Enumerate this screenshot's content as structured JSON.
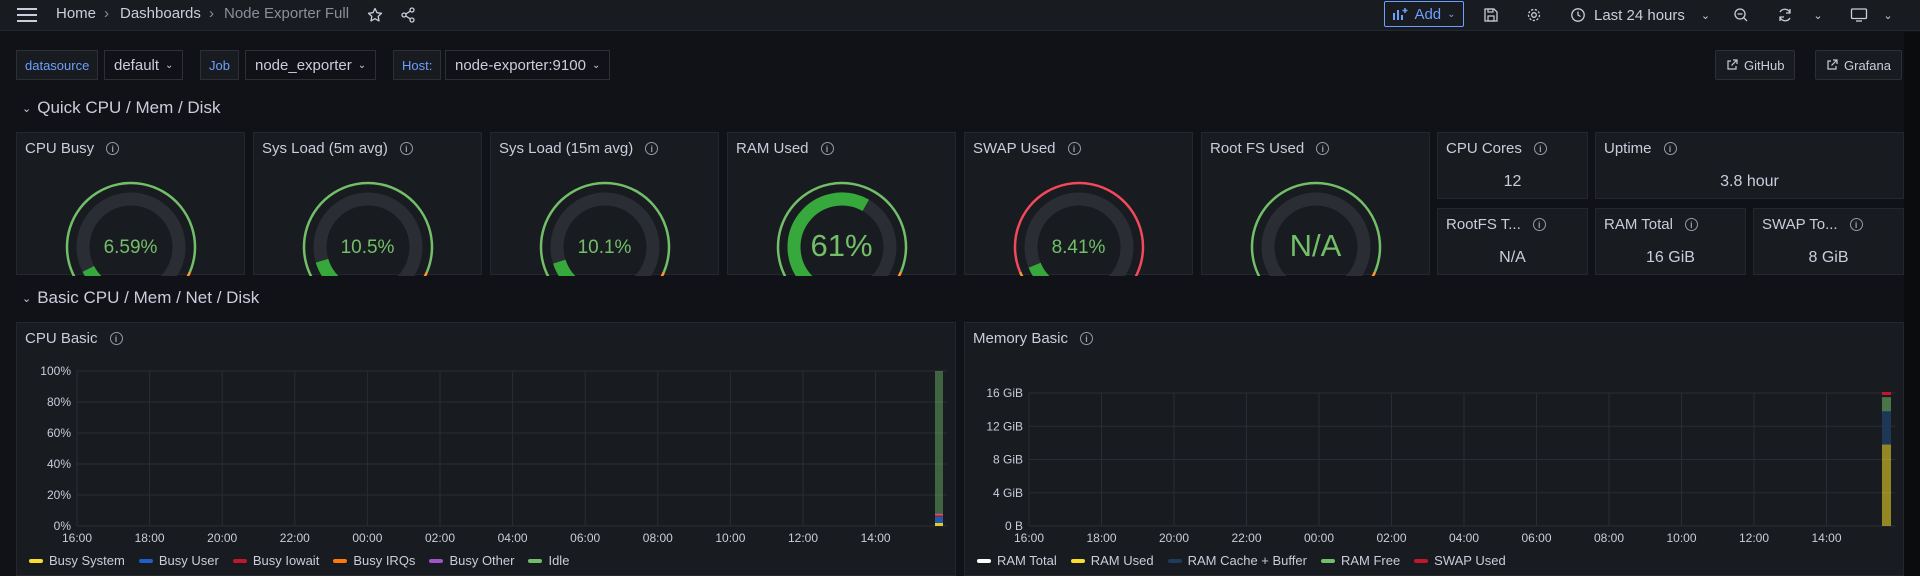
{
  "nav": {
    "breadcrumb": [
      "Home",
      "Dashboards",
      "Node Exporter Full"
    ],
    "add_label": "Add",
    "time_range": "Last 24 hours"
  },
  "variables": [
    {
      "label": "datasource",
      "value": "default"
    },
    {
      "label": "Job",
      "value": "node_exporter"
    },
    {
      "label": "Host:",
      "value": "node-exporter:9100"
    }
  ],
  "links": [
    "GitHub",
    "Grafana"
  ],
  "rows": {
    "quick": "Quick CPU / Mem / Disk",
    "basic": "Basic CPU / Mem / Net / Disk"
  },
  "gauges": [
    {
      "title": "CPU Busy",
      "value": "6.59%",
      "fraction": 0.066,
      "threshold": "green-orange-red"
    },
    {
      "title": "Sys Load (5m avg)",
      "value": "10.5%",
      "fraction": 0.105,
      "threshold": "green-orange-red"
    },
    {
      "title": "Sys Load (15m avg)",
      "value": "10.1%",
      "fraction": 0.101,
      "threshold": "green-orange-red"
    },
    {
      "title": "RAM Used",
      "value": "61%",
      "fraction": 0.61,
      "threshold": "green-orange-red"
    },
    {
      "title": "SWAP Used",
      "value": "8.41%",
      "fraction": 0.084,
      "threshold": "orange-red"
    },
    {
      "title": "Root FS Used",
      "value": "N/A",
      "fraction": 0,
      "threshold": "green-orange-red"
    }
  ],
  "stats": [
    {
      "title": "CPU Cores",
      "value": "12"
    },
    {
      "title": "Uptime",
      "value": "3.8 hour"
    },
    {
      "title": "RootFS T...",
      "value": "N/A"
    },
    {
      "title": "RAM Total",
      "value": "16 GiB"
    },
    {
      "title": "SWAP To...",
      "value": "8 GiB"
    }
  ],
  "panels": {
    "cpu_basic": "CPU Basic",
    "memory_basic": "Memory Basic"
  },
  "chart_data": [
    {
      "type": "area",
      "title": "CPU Basic",
      "y_ticks": [
        "100%",
        "80%",
        "60%",
        "40%",
        "20%",
        "0%"
      ],
      "x_ticks": [
        "16:00",
        "18:00",
        "20:00",
        "22:00",
        "00:00",
        "02:00",
        "04:00",
        "06:00",
        "08:00",
        "10:00",
        "12:00",
        "14:00"
      ],
      "ylim": [
        0,
        100
      ],
      "grid": true,
      "series": [
        {
          "name": "Busy System",
          "color": "#fade2a",
          "values": [
            2
          ]
        },
        {
          "name": "Busy User",
          "color": "#1f60c4",
          "values": [
            4
          ]
        },
        {
          "name": "Busy Iowait",
          "color": "#c4162a",
          "values": [
            1
          ]
        },
        {
          "name": "Busy IRQs",
          "color": "#ff780a",
          "values": [
            0.5
          ]
        },
        {
          "name": "Busy Other",
          "color": "#a352cc",
          "values": [
            0.5
          ]
        },
        {
          "name": "Idle",
          "color": "#73bf69",
          "values": [
            92
          ]
        }
      ]
    },
    {
      "type": "area",
      "title": "Memory Basic",
      "y_ticks": [
        "16 GiB",
        "12 GiB",
        "8 GiB",
        "4 GiB",
        "0 B"
      ],
      "x_ticks": [
        "16:00",
        "18:00",
        "20:00",
        "22:00",
        "00:00",
        "02:00",
        "04:00",
        "06:00",
        "08:00",
        "10:00",
        "12:00",
        "14:00"
      ],
      "ylim": [
        0,
        16
      ],
      "grid": true,
      "series": [
        {
          "name": "RAM Total",
          "color": "#ffffff",
          "values": [
            16
          ]
        },
        {
          "name": "RAM Used",
          "color": "#fade2a",
          "values": [
            9.8
          ]
        },
        {
          "name": "RAM Cache + Buffer",
          "color": "#1f3b5c",
          "values": [
            4
          ]
        },
        {
          "name": "RAM Free",
          "color": "#73bf69",
          "values": [
            1.7
          ]
        },
        {
          "name": "SWAP Used",
          "color": "#c4162a",
          "values": [
            0.5
          ]
        }
      ]
    }
  ]
}
